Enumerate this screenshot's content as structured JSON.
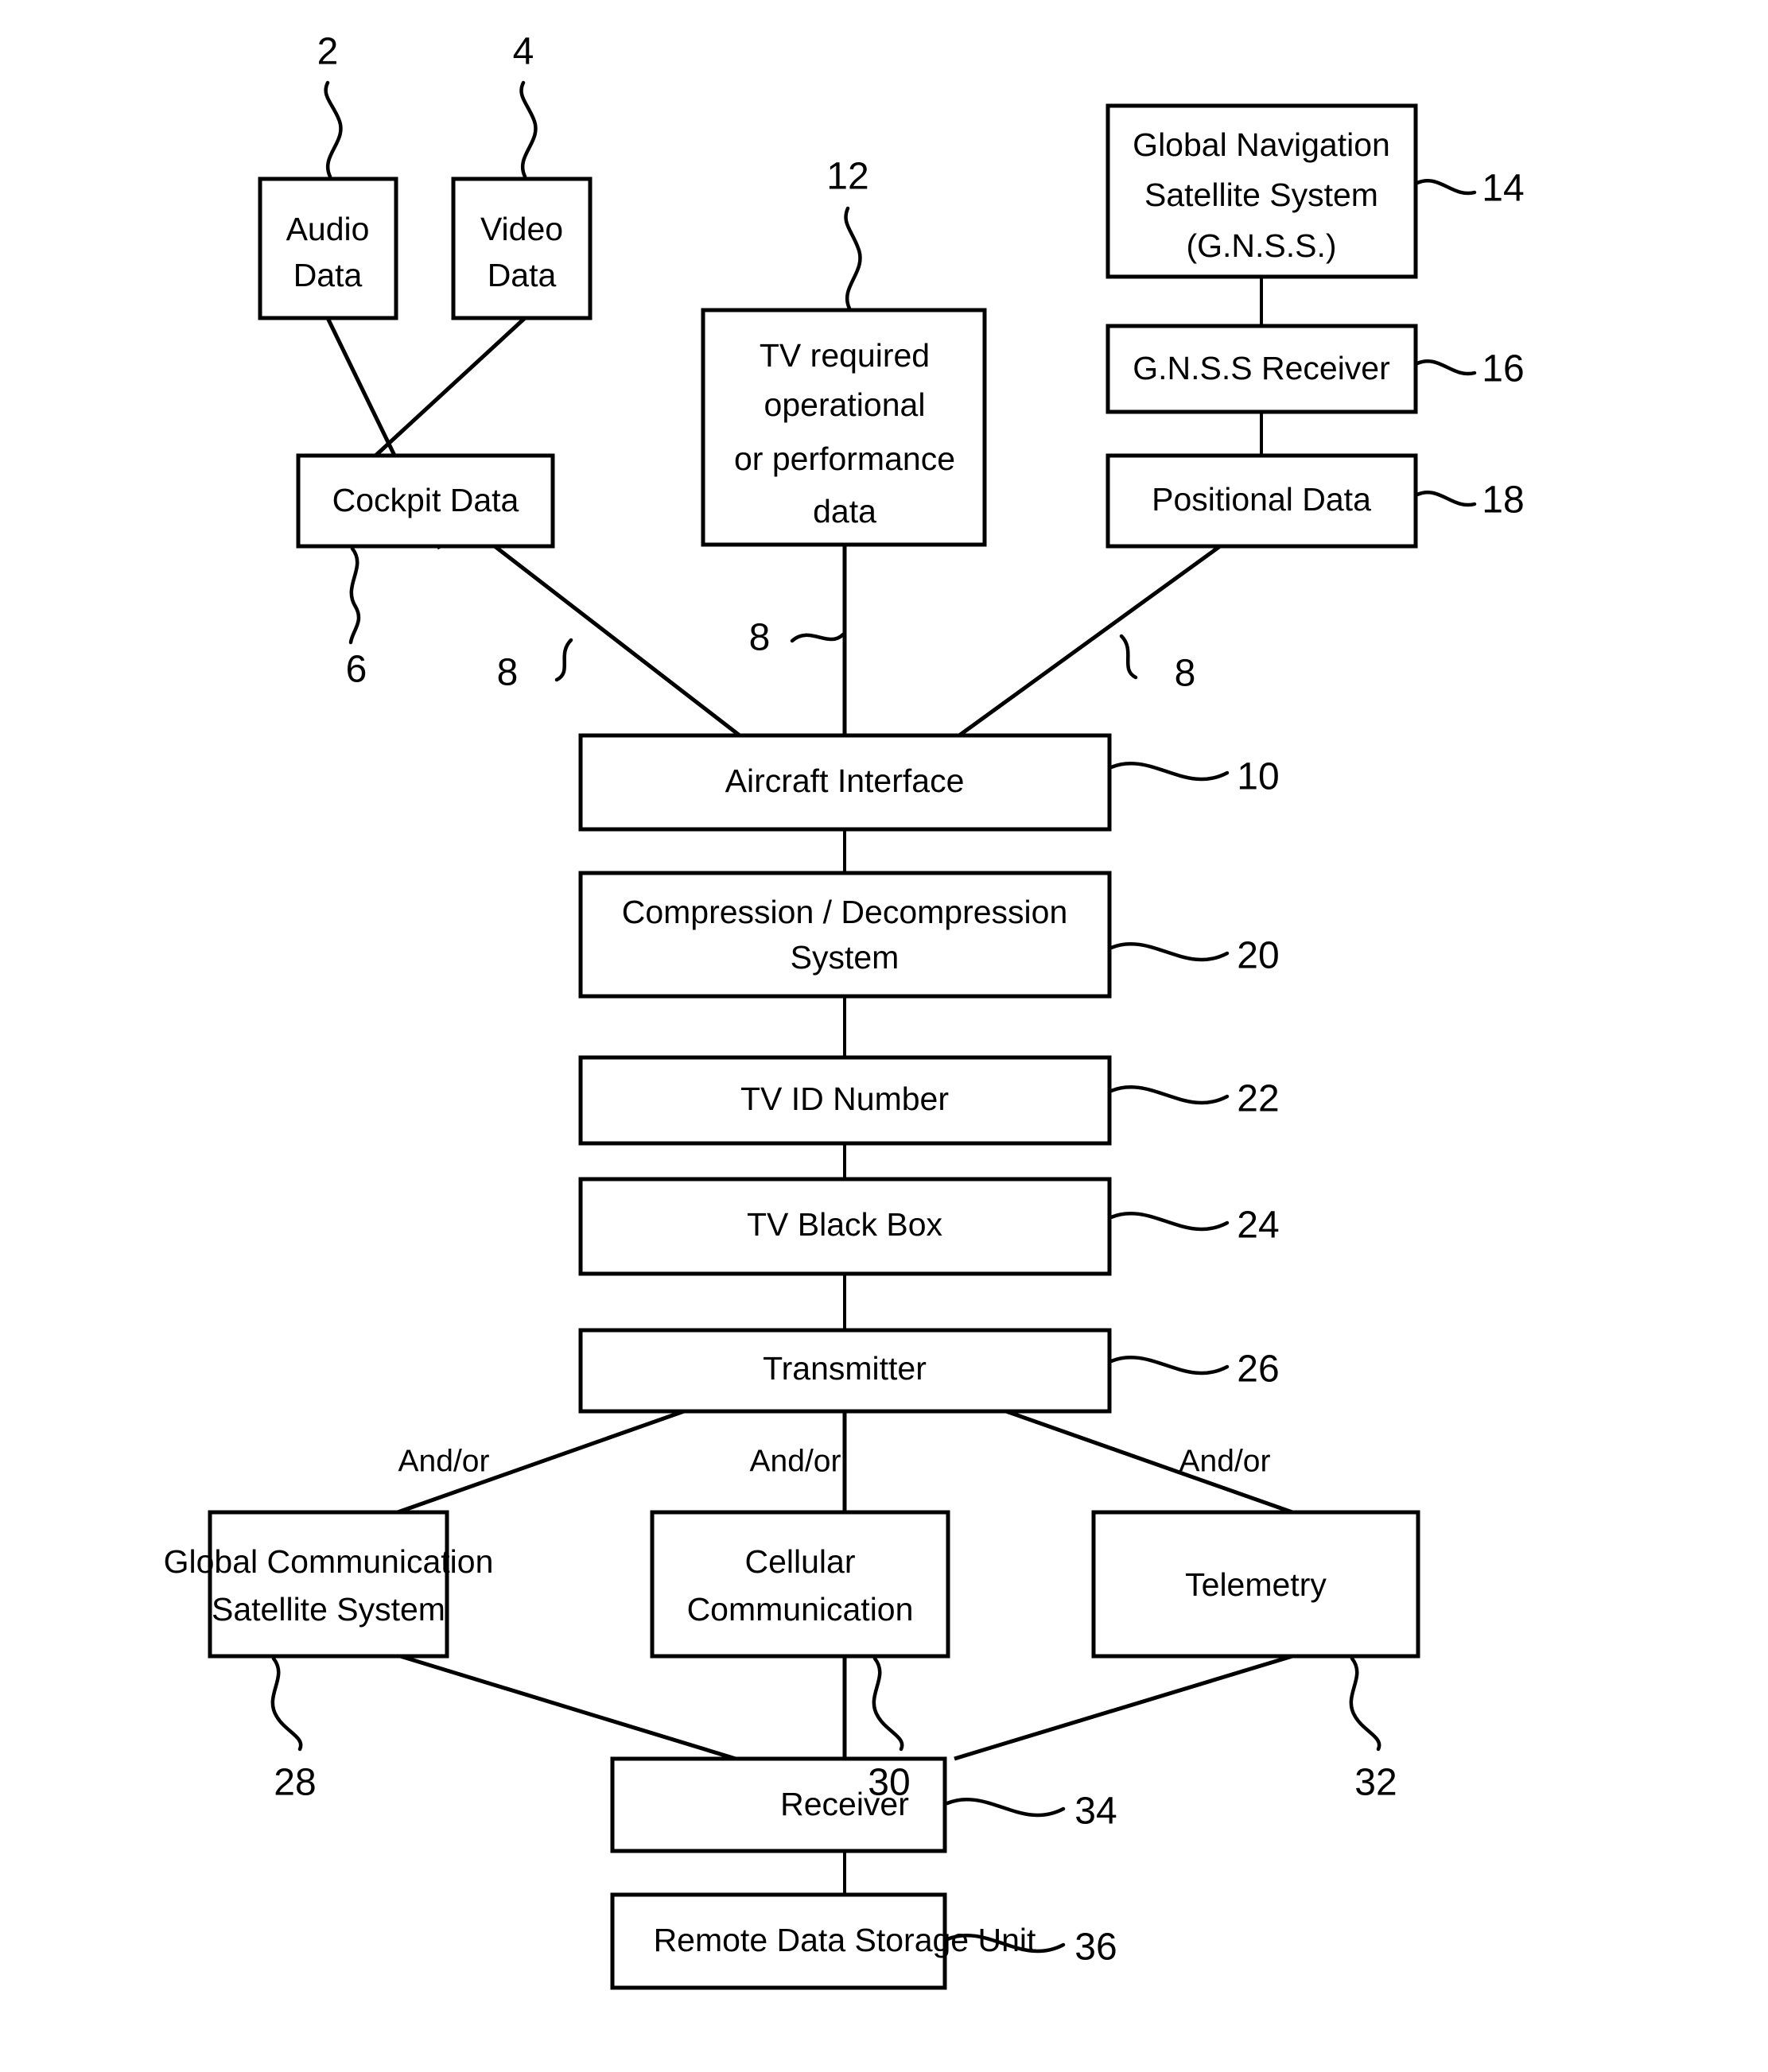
{
  "figure": {
    "type": "patent-block-diagram",
    "background_color": "#ffffff",
    "line_color": "#000000"
  },
  "nodes": {
    "audio_data": {
      "label_line1": "Audio",
      "label_line2": "Data",
      "ref": "2"
    },
    "video_data": {
      "label_line1": "Video",
      "label_line2": "Data",
      "ref": "4"
    },
    "cockpit_data": {
      "label": "Cockpit Data",
      "ref": "6"
    },
    "tv_required": {
      "label_line1": "TV required",
      "label_line2": "operational",
      "label_line3": "or performance",
      "label_line4": "data",
      "ref": "12"
    },
    "gnss": {
      "label_line1": "Global Navigation",
      "label_line2": "Satellite System",
      "label_line3": "(G.N.S.S.)",
      "ref": "14"
    },
    "gnss_receiver": {
      "label": "G.N.S.S Receiver",
      "ref": "16"
    },
    "positional_data": {
      "label": "Positional Data",
      "ref": "18"
    },
    "aircraft_interface": {
      "label": "Aircraft Interface",
      "ref": "10"
    },
    "compression": {
      "label_line1": "Compression / Decompression",
      "label_line2": "System",
      "ref": "20"
    },
    "tv_id_number": {
      "label": "TV ID Number",
      "ref": "22"
    },
    "tv_black_box": {
      "label": "TV Black Box",
      "ref": "24"
    },
    "transmitter": {
      "label": "Transmitter",
      "ref": "26"
    },
    "global_comm_sat": {
      "label_line1": "Global Communication",
      "label_line2": "Satellite System",
      "ref": "28"
    },
    "cellular_comm": {
      "label_line1": "Cellular",
      "label_line2": "Communication",
      "ref": "30"
    },
    "telemetry": {
      "label": "Telemetry",
      "ref": "32"
    },
    "receiver": {
      "label": "Receiver",
      "ref": "34"
    },
    "remote_storage": {
      "label": "Remote Data Storage Unit",
      "ref": "36"
    }
  },
  "edge_labels": {
    "data_bus_left": "8",
    "data_bus_center": "8",
    "data_bus_right": "8",
    "andor_left": "And/or",
    "andor_center": "And/or",
    "andor_right": "And/or"
  }
}
